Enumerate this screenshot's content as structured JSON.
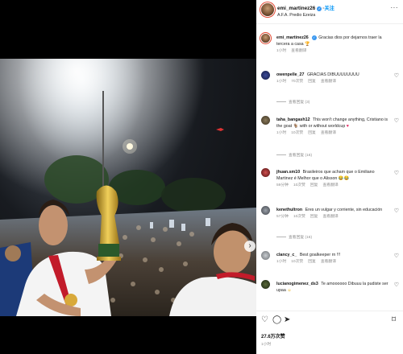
{
  "colors": {
    "accent": "#0095f6",
    "verified": "#3897f0",
    "story_ring": "#e2452e"
  },
  "post": {
    "username": "emi_martinez26",
    "follow_label": "关注",
    "location": "A.F.A. Predio Ezeiza",
    "more_icon": "ellipsis-icon",
    "carousel_next_icon": "chevron-right-icon"
  },
  "caption": {
    "username": "emi_martinez26",
    "text": "Gracias dios por dejarnos traer la tercera a casa",
    "time": "1小时",
    "translate": "查看翻译"
  },
  "comments": [
    {
      "username": "owenpelle_27",
      "text": "GRACIAS DIBUUUUUUUU",
      "time": "1小时",
      "likes": "70次赞",
      "reply": "回复",
      "translate": "查看翻译",
      "replies": "查看回复 (3)"
    },
    {
      "username": "taha_bangash12",
      "text": "This won't change anything, Cristiano is the goat",
      "text_after": "with or without worldcup",
      "time": "1小时",
      "likes": "10次赞",
      "reply": "回复",
      "translate": "查看翻译",
      "replies": "查看回复 (16)"
    },
    {
      "username": "jhuan.sm10",
      "text": "Brasileiros que acham que o Emiliano Martinez é Melhor que o Alisson",
      "time": "59分钟",
      "likes": "10次赞",
      "reply": "回复",
      "translate": "查看翻译"
    },
    {
      "username": "kenethultron",
      "text": "Eres un vulgar y corriente, sin educación",
      "time": "57分钟",
      "likes": "10次赞",
      "reply": "回复",
      "translate": "查看翻译",
      "replies": "查看回复 (16)"
    },
    {
      "username": "clancy_c_",
      "text": "Best goalkeeper rn !!!",
      "time": "1小时",
      "likes": "10次赞",
      "reply": "回复",
      "translate": "查看翻译"
    },
    {
      "username": "lucianogimenez_ds3",
      "text": "Te amoooooo Dibuuu la pudiste ser upaa",
      "time": "1小时",
      "likes": "10次赞",
      "reply": "回复",
      "translate": "查看翻译"
    }
  ],
  "actions": {
    "likes_count": "27.6万次赞",
    "age": "1小时"
  }
}
